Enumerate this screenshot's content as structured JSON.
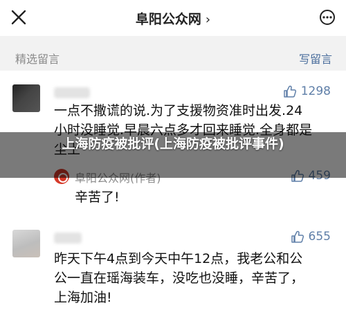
{
  "header": {
    "title": "阜阳公众网",
    "title_chevron": "›"
  },
  "section": {
    "title": "精选留言",
    "write_label": "写留言"
  },
  "comments": [
    {
      "text_lines": [
        "一点不撒谎的说.为了支援物资准时出发.24",
        "小时没睡觉.早晨六点多才回来睡觉.全身都是",
        "尘土"
      ],
      "likes": "1298",
      "reply": {
        "author": "阜阳公众网(作者)",
        "text": "辛苦了!",
        "likes": "459"
      }
    },
    {
      "text_lines": [
        "昨天下午4点到今天中午12点，我老公和公",
        "公一直在瑶海装车，没吃也没睡，辛苦了，",
        "上海加油!"
      ],
      "likes": "655"
    }
  ],
  "overlay": {
    "text": "上海防疫被批评(上海防疫被批评事件)"
  },
  "colors": {
    "accent": "#5f7fa8",
    "overlay": "rgba(0,0,0,0.52)"
  },
  "icons": {
    "close": "close-icon",
    "more": "more-icon",
    "like": "thumbs-up-icon",
    "author_badge": "author-avatar-icon"
  }
}
